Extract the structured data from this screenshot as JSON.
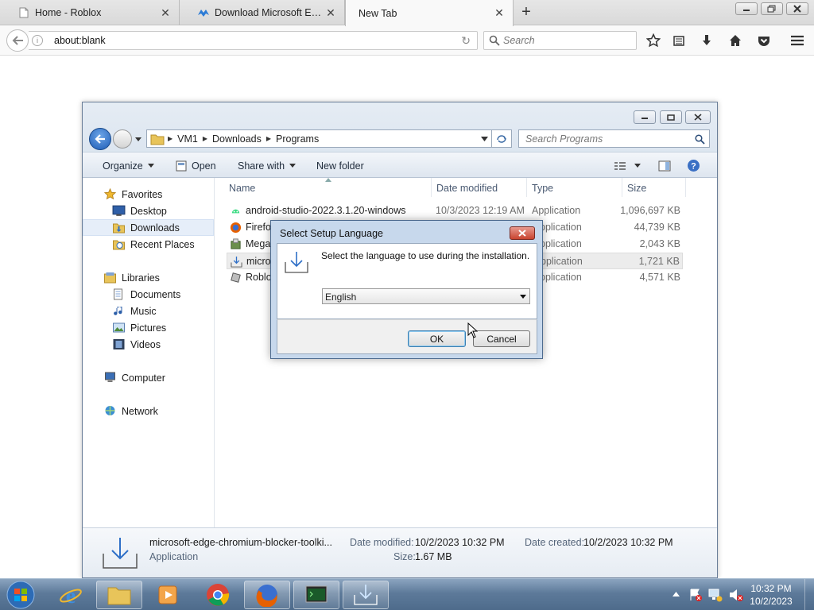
{
  "browser": {
    "tabs": [
      {
        "title": "Home - Roblox",
        "active": false
      },
      {
        "title": "Download Microsoft Edge ...",
        "active": false
      },
      {
        "title": "New Tab",
        "active": true
      }
    ],
    "url": "about:blank",
    "search_placeholder": "Search"
  },
  "explorer": {
    "breadcrumb": [
      "VM1",
      "Downloads",
      "Programs"
    ],
    "search_placeholder": "Search Programs",
    "toolbar": {
      "organize": "Organize",
      "open": "Open",
      "share_with": "Share with",
      "new_folder": "New folder"
    },
    "sidebar": {
      "favorites": "Favorites",
      "fav_items": [
        "Desktop",
        "Downloads",
        "Recent Places"
      ],
      "libraries": "Libraries",
      "lib_items": [
        "Documents",
        "Music",
        "Pictures",
        "Videos"
      ],
      "computer": "Computer",
      "network": "Network"
    },
    "columns": {
      "name": "Name",
      "date": "Date modified",
      "type": "Type",
      "size": "Size"
    },
    "files": [
      {
        "name": "android-studio-2022.3.1.20-windows",
        "date": "10/3/2023 12:19 AM",
        "type": "Application",
        "size": "1,096,697 KB"
      },
      {
        "name": "Firefo",
        "date": "",
        "type": "pplication",
        "size": "44,739 KB"
      },
      {
        "name": "Mega",
        "date": "",
        "type": "pplication",
        "size": "2,043 KB"
      },
      {
        "name": "micro",
        "date": "",
        "type": "pplication",
        "size": "1,721 KB"
      },
      {
        "name": "Roblo",
        "date": "",
        "type": "pplication",
        "size": "4,571 KB"
      }
    ],
    "details": {
      "name": "microsoft-edge-chromium-blocker-toolki...",
      "kind": "Application",
      "modified_label": "Date modified:",
      "modified_value": "10/2/2023 10:32 PM",
      "created_label": "Date created:",
      "created_value": "10/2/2023 10:32 PM",
      "size_label": "Size:",
      "size_value": "1.67 MB"
    }
  },
  "dialog": {
    "title": "Select Setup Language",
    "message": "Select the language to use during the installation.",
    "selected_language": "English",
    "ok": "OK",
    "cancel": "Cancel"
  },
  "taskbar": {
    "time": "10:32 PM",
    "date": "10/2/2023"
  }
}
